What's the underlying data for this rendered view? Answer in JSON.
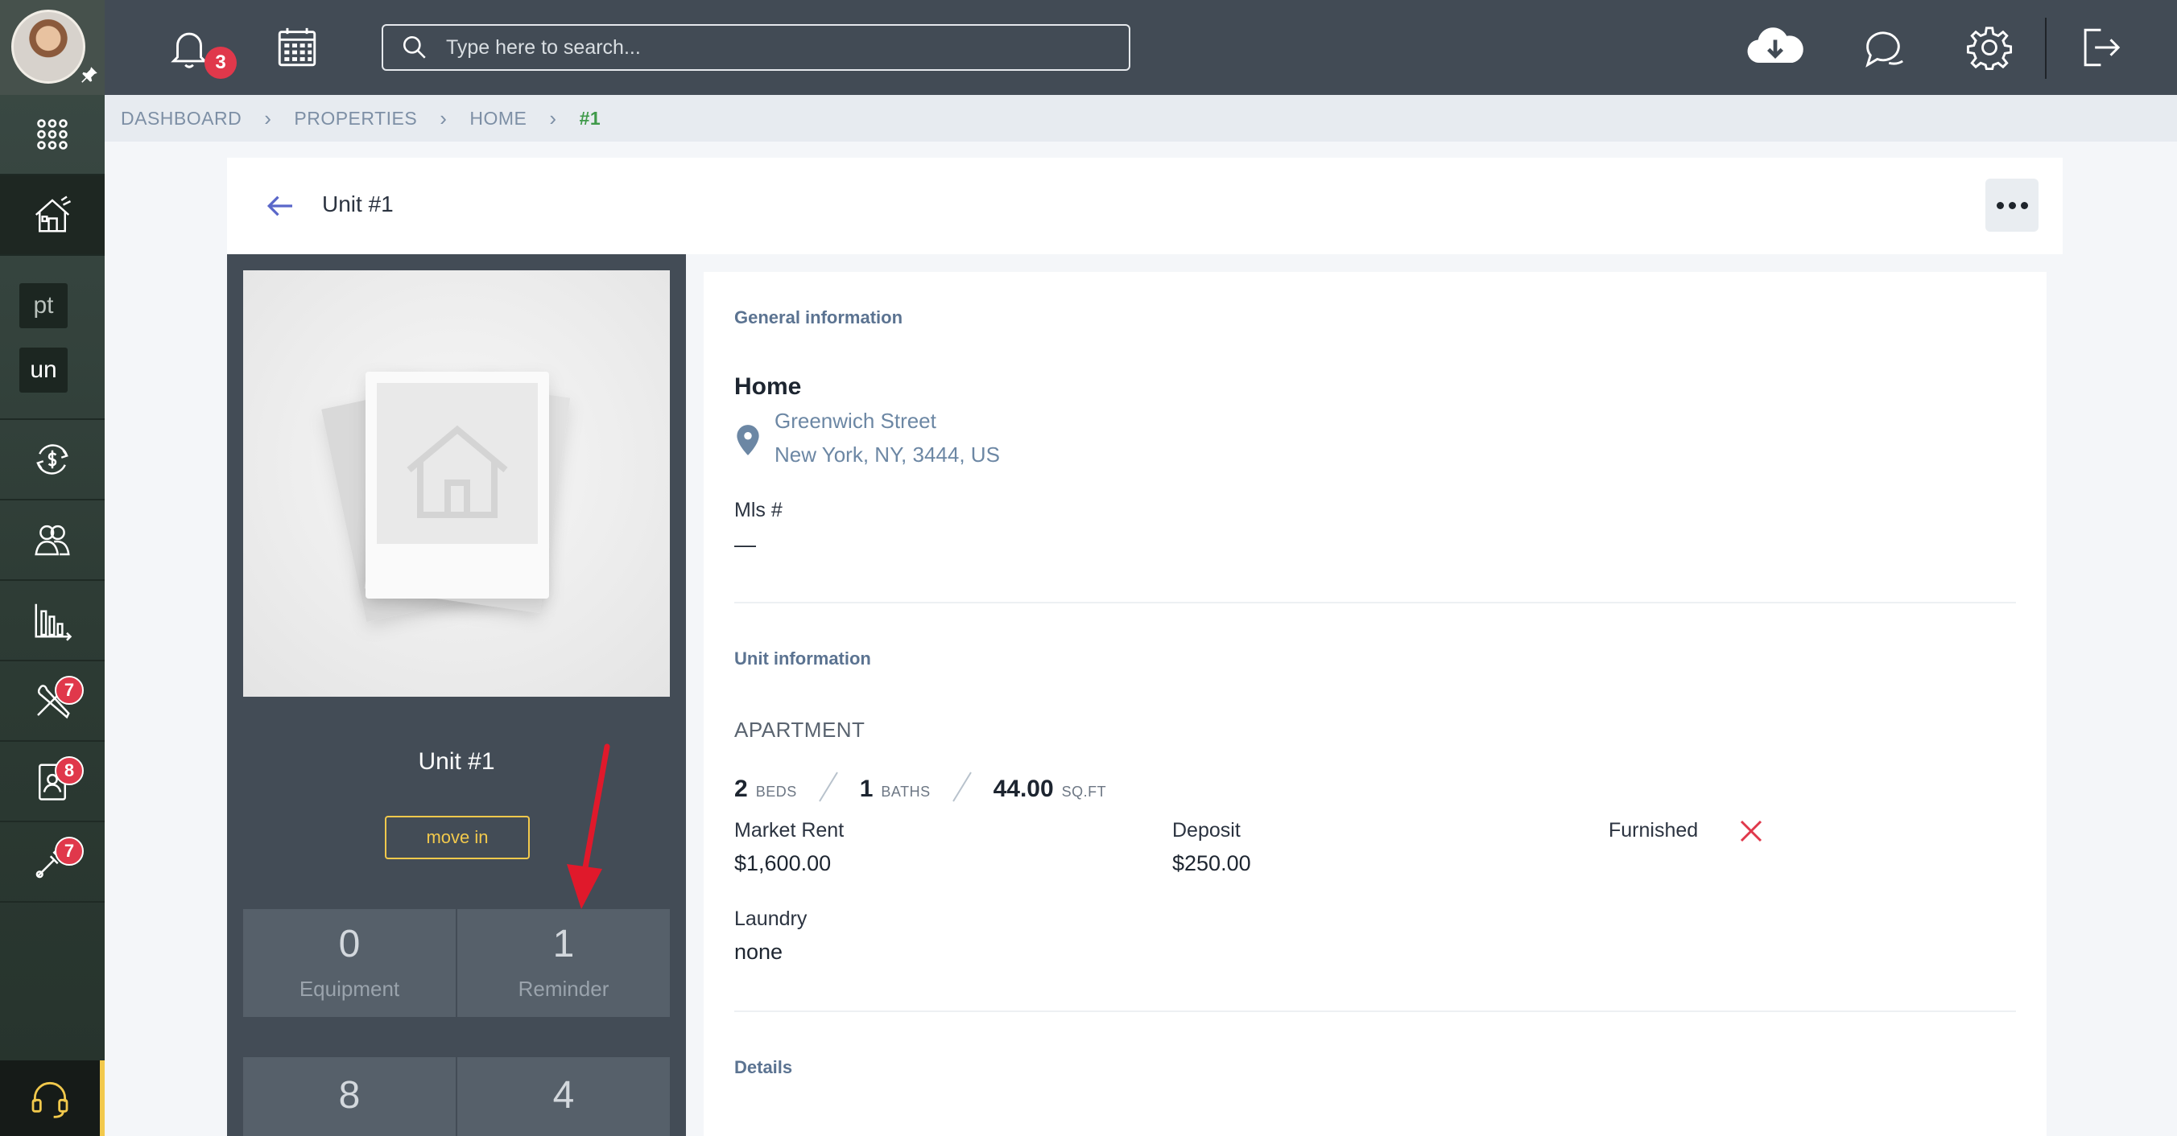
{
  "topbar": {
    "notifications_count": "3",
    "search_placeholder": "Type here to search..."
  },
  "sidebar": {
    "tiles": [
      "pt",
      "un"
    ],
    "badges": {
      "maintenance": "7",
      "applications": "8",
      "tools": "7"
    }
  },
  "breadcrumb": [
    "DASHBOARD",
    "PROPERTIES",
    "HOME",
    "#1"
  ],
  "header": {
    "title": "Unit #1"
  },
  "unit_panel": {
    "name": "Unit #1",
    "move_in_label": "move in",
    "stats": [
      {
        "value": "0",
        "label": "Equipment"
      },
      {
        "value": "1",
        "label": "Reminder"
      },
      {
        "value": "8",
        "label": ""
      },
      {
        "value": "4",
        "label": ""
      }
    ]
  },
  "general_info": {
    "section_title": "General information",
    "property_name": "Home",
    "address_line1": "Greenwich Street",
    "address_line2": "New York, NY, 3444, US",
    "mls_label": "Mls #",
    "mls_value": "—"
  },
  "unit_info": {
    "section_title": "Unit information",
    "type": "APARTMENT",
    "beds_value": "2",
    "beds_unit": "BEDS",
    "baths_value": "1",
    "baths_unit": "BATHS",
    "sqft_value": "44.00",
    "sqft_unit": "SQ.FT",
    "market_rent_label": "Market Rent",
    "market_rent_value": "$1,600.00",
    "deposit_label": "Deposit",
    "deposit_value": "$250.00",
    "furnished_label": "Furnished",
    "laundry_label": "Laundry",
    "laundry_value": "none"
  },
  "details": {
    "section_title": "Details"
  },
  "colors": {
    "sidebar_bg": "#2c3a33",
    "topbar_bg": "#424b55",
    "panel_bg": "#434c56",
    "badge_red": "#e0384b",
    "accent_yellow": "#f2c94c",
    "link_blue": "#6c87a4",
    "breadcrumb_current": "#3f9a4a"
  }
}
